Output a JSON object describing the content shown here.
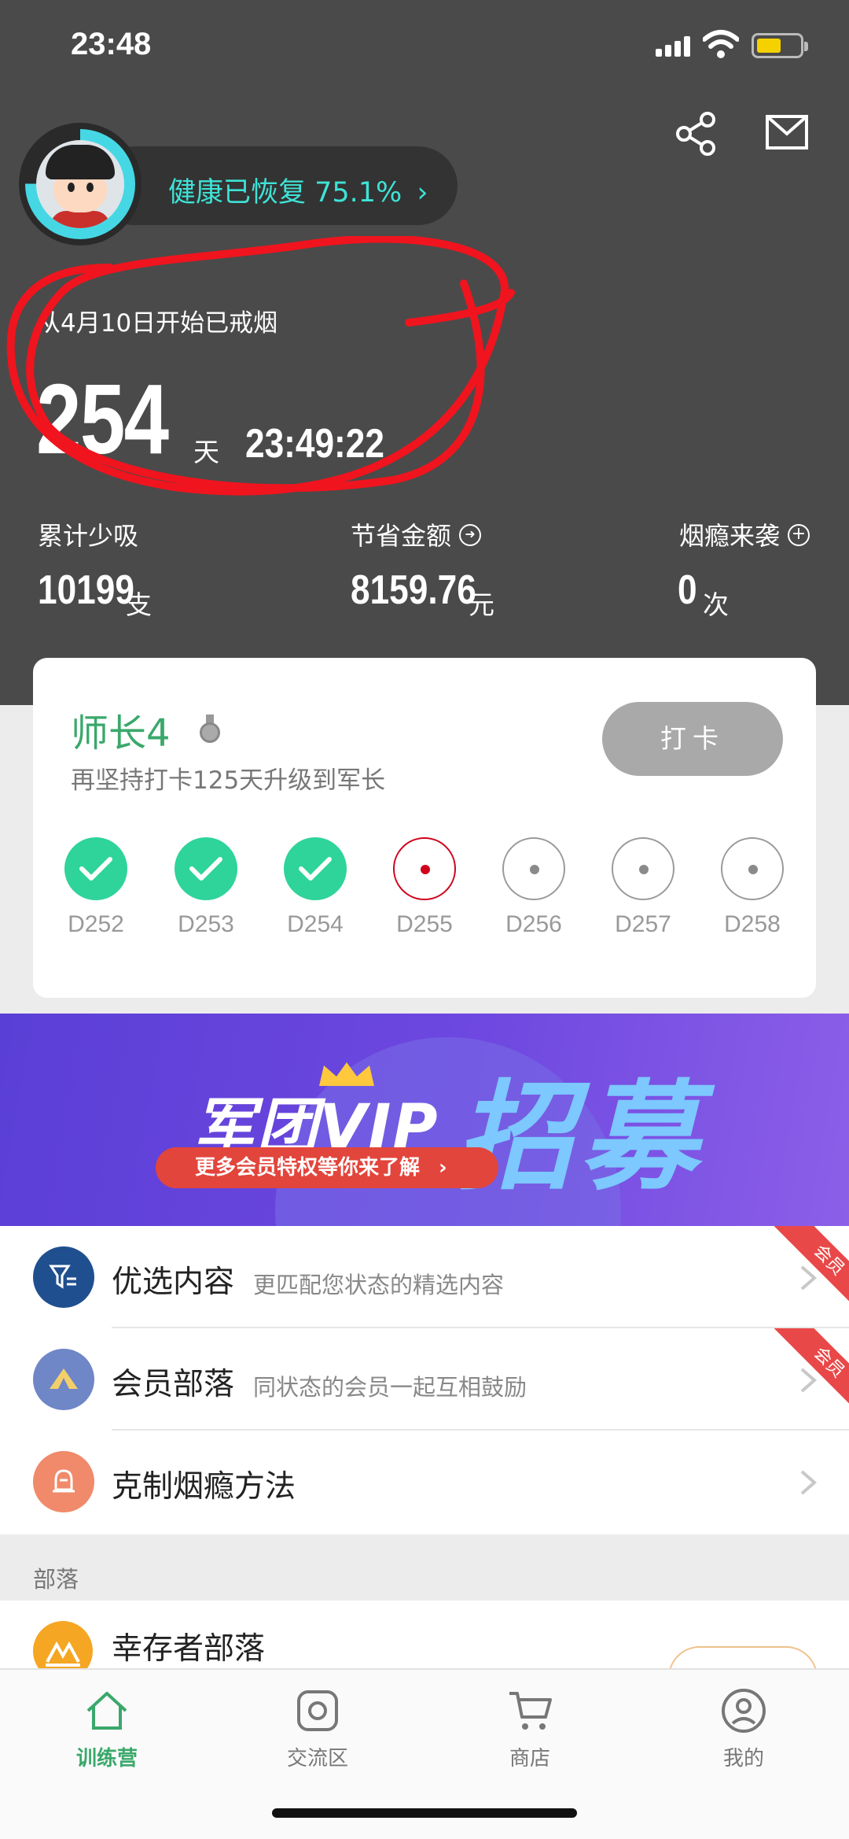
{
  "status": {
    "time": "23:48"
  },
  "header": {
    "health_text": "健康已恢复 75.1%",
    "health_chevron": "›",
    "health_percent": 75.1
  },
  "streak": {
    "label": "从4月10日开始已戒烟",
    "days": "254",
    "days_unit": "天",
    "clock": "23:49:22"
  },
  "stats": [
    {
      "label": "累计少吸",
      "value": "10199",
      "unit": "支",
      "icon": ""
    },
    {
      "label": "节省金额",
      "value": "8159.76",
      "unit": "元",
      "icon": "arrow-circle-icon"
    },
    {
      "label": "烟瘾来袭",
      "value": "0",
      "unit": "次",
      "icon": "plus-circle-icon"
    }
  ],
  "stat_icons": {
    "arrow": "➜",
    "plus": "+"
  },
  "rank": {
    "title": "师长4",
    "subtitle": "再坚持打卡125天升级到军长",
    "checkin_label": "打卡",
    "days": [
      {
        "label": "D252",
        "state": "done"
      },
      {
        "label": "D253",
        "state": "done"
      },
      {
        "label": "D254",
        "state": "done"
      },
      {
        "label": "D255",
        "state": "today"
      },
      {
        "label": "D256",
        "state": "future"
      },
      {
        "label": "D257",
        "state": "future"
      },
      {
        "label": "D258",
        "state": "future"
      }
    ]
  },
  "banner": {
    "title": "军团VIP",
    "big_text": "招募",
    "pill_text": "更多会员特权等你来了解",
    "pill_chevron": "›"
  },
  "list": [
    {
      "title": "优选内容",
      "desc": "更匹配您状态的精选内容",
      "badge": "会员",
      "icon": "filter-list-icon",
      "color": "#1f4f8f"
    },
    {
      "title": "会员部落",
      "desc": "同状态的会员一起互相鼓励",
      "badge": "会员",
      "icon": "tent-icon",
      "color": "#6f86c7"
    },
    {
      "title": "克制烟瘾方法",
      "desc": "",
      "badge": "",
      "icon": "bell-icon",
      "color": "#f08a6a"
    }
  ],
  "section": {
    "label": "部落"
  },
  "tribe": {
    "title": "幸存者部落"
  },
  "tabs": [
    {
      "label": "训练营",
      "icon": "home-icon",
      "active": true
    },
    {
      "label": "交流区",
      "icon": "chat-icon",
      "active": false
    },
    {
      "label": "商店",
      "icon": "cart-icon",
      "active": false
    },
    {
      "label": "我的",
      "icon": "user-icon",
      "active": false
    }
  ],
  "colors": {
    "accent": "#3aa86b",
    "teal": "#3ee3d6",
    "header_bg": "#4a4a4a",
    "done": "#2ed49a",
    "today": "#d0021b"
  }
}
